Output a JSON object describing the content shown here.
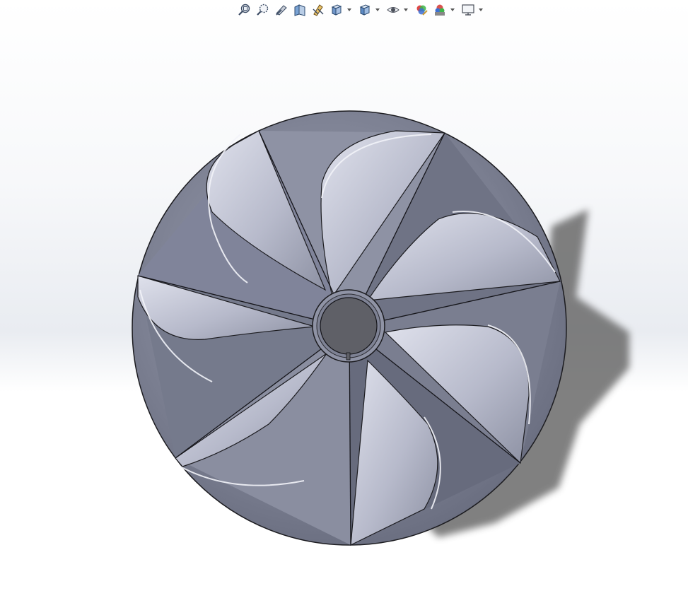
{
  "toolbar": {
    "items": [
      {
        "icon": "zoom-to-fit-icon",
        "dropdown": false
      },
      {
        "icon": "zoom-to-area-icon",
        "dropdown": false
      },
      {
        "icon": "previous-view-icon",
        "dropdown": false
      },
      {
        "icon": "section-view-icon",
        "dropdown": false
      },
      {
        "icon": "dynamic-annotation-views-icon",
        "dropdown": false
      },
      {
        "icon": "view-orientation-icon",
        "dropdown": true
      },
      {
        "icon": "display-style-icon",
        "dropdown": true
      },
      {
        "icon": "hide-show-items-icon",
        "dropdown": true
      },
      {
        "icon": "edit-appearance-icon",
        "dropdown": false
      },
      {
        "icon": "apply-scene-icon",
        "dropdown": true
      },
      {
        "icon": "view-setting-icon",
        "dropdown": true
      }
    ]
  },
  "model": {
    "name": "impeller",
    "blade_count": 7,
    "colors": {
      "body": "#7c8090",
      "body_light": "#a7abbd",
      "blade_light": "#d4d6e3",
      "hub": "#5f6067",
      "shadow": "#6b6b6b",
      "edge": "#1c1c20"
    }
  }
}
